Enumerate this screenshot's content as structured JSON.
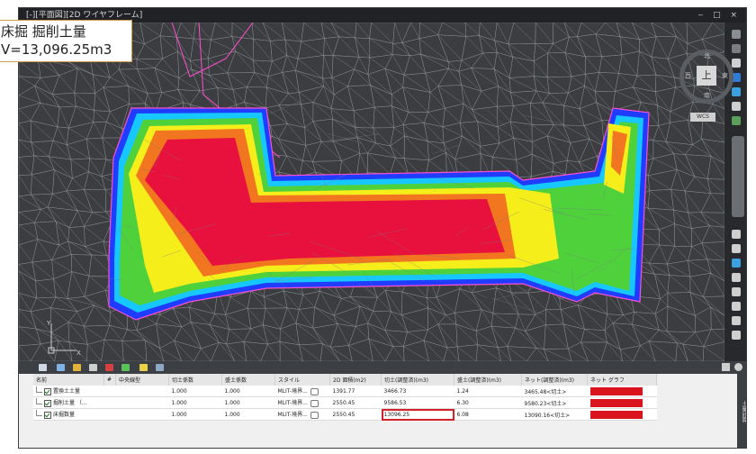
{
  "window": {
    "title": "[-][平面図][2D ワイヤフレーム]",
    "controls": "‒ □ ×"
  },
  "callout": {
    "line1": "床掘 掘削土量",
    "line2": "V=13,096.25m3"
  },
  "viewcube": {
    "face": "上",
    "north": "北",
    "south": "南",
    "east": "東",
    "west": "西",
    "wcs": "WCS"
  },
  "ucs": {
    "y": "Y",
    "x": "X"
  },
  "side_panel_label": "土量計算",
  "table": {
    "headers": [
      "名前",
      "#",
      "中央線型",
      "切土係数",
      "盛土係数",
      "スタイル",
      "2D 面積(m2)",
      "切土(調整済)(m3)",
      "盛土(調整済)(m3)",
      "ネット(調整済)(m3)",
      "ネット グラフ"
    ],
    "rows": [
      {
        "name": "置換土土量",
        "num": "",
        "centerline": "",
        "cut_factor": "1.000",
        "fill_factor": "1.000",
        "style": "MLIT-境界...",
        "area": "1391.77",
        "cut": "3466.73",
        "fill": "1.24",
        "net": "3465.48<切土>",
        "highlight": false
      },
      {
        "name": "掘削土量 （…",
        "num": "",
        "centerline": "",
        "cut_factor": "1.000",
        "fill_factor": "1.000",
        "style": "MLIT-境界...",
        "area": "2550.45",
        "cut": "9586.53",
        "fill": "6.30",
        "net": "9580.23<切土>",
        "highlight": false
      },
      {
        "name": "床掘数量",
        "num": "",
        "centerline": "",
        "cut_factor": "1.000",
        "fill_factor": "1.000",
        "style": "MLIT-境界...",
        "area": "2550.45",
        "cut": "13096.25",
        "fill": "6.08",
        "net": "13090.16<切土>",
        "highlight": true
      }
    ]
  },
  "colors": {
    "mesh_bg": "#3b3d40",
    "mesh_line": "#8e9196",
    "boundary": "#ff4fd0",
    "blue": "#1f3cff",
    "cyan": "#16c8ff",
    "green": "#4fd13c",
    "yellow": "#f5ee1a",
    "orange": "#f2751f",
    "red": "#e8103c",
    "net_bar": "#d9141e",
    "highlight_border": "#d4202a"
  }
}
